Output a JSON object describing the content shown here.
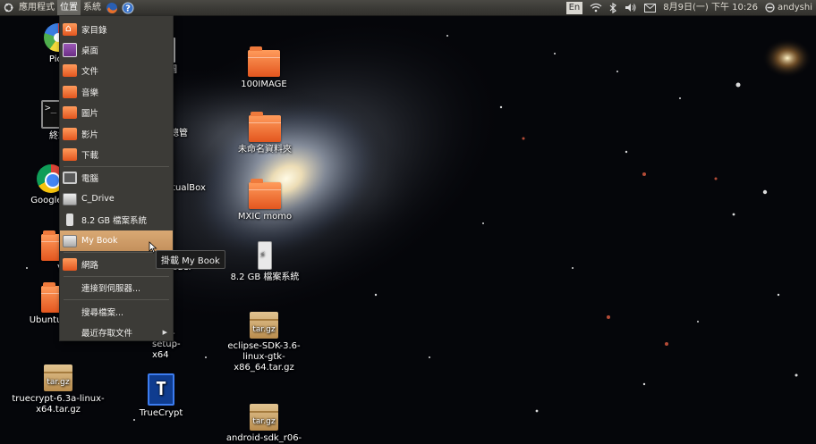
{
  "top_panel": {
    "applications_label": "應用程式",
    "places_label": "位置",
    "system_label": "系統",
    "launchers": [
      {
        "icon": "firefox-icon",
        "color": "#e8702a"
      },
      {
        "icon": "help-icon",
        "color": "#3b73c9"
      }
    ],
    "indicators": {
      "input_method": "En",
      "datetime": "8月9日(一) 下午 10:26",
      "user": "andyshi"
    }
  },
  "places_menu": {
    "items": [
      {
        "label": "家目錄",
        "icon": "home-folder-icon"
      },
      {
        "label": "桌面",
        "icon": "desktop-folder-icon"
      },
      {
        "label": "文件",
        "icon": "documents-folder-icon"
      },
      {
        "label": "音樂",
        "icon": "music-folder-icon"
      },
      {
        "label": "圖片",
        "icon": "pictures-folder-icon"
      },
      {
        "label": "影片",
        "icon": "videos-folder-icon"
      },
      {
        "label": "下載",
        "icon": "downloads-folder-icon"
      },
      {
        "label": "電腦",
        "icon": "computer-icon"
      },
      {
        "label": "C_Drive",
        "icon": "drive-icon"
      },
      {
        "label": "8.2 GB 檔案系統",
        "icon": "usb-drive-icon"
      },
      {
        "label": "My Book",
        "icon": "external-drive-icon",
        "highlighted": true
      },
      {
        "label": "網路",
        "icon": "network-icon"
      },
      {
        "label": "連接到伺服器..."
      },
      {
        "label": "搜尋檔案..."
      },
      {
        "label": "最近存取文件",
        "submenu": true
      }
    ]
  },
  "tooltip": {
    "text": "掛載 My Book"
  },
  "desktop_icons": {
    "picasa": "Pica",
    "terminal": "終端",
    "chrome": "Google C",
    "vi": "VI",
    "ubuntu": "Ubuntu",
    "truecrypt_archive": "truecrypt-6.3a-linux-x64.tar.gz",
    "truecrypt_app": "TrueCrypt",
    "hidden_1": "截圖",
    "hidden_2": "總管",
    "hidden_3": "rtualBox",
    "hidden_4": "ader",
    "hidden_5": "6.3a-setup-x64",
    "folder_100image": "100IMAGE",
    "folder_untitled": "未命名資料夾",
    "folder_mxic": "MXIC momo",
    "usb_fs": "8.2 GB 檔案系統",
    "eclipse": "eclipse-SDK-3.6-linux-gtk-x86_64.tar.gz",
    "android": "android-sdk_r06-",
    "archive_badge": "tar.gz"
  },
  "colors": {
    "panel": "#3c3b37",
    "menu_highlight": "#c4905c",
    "folder_orange": "#e3561f"
  }
}
